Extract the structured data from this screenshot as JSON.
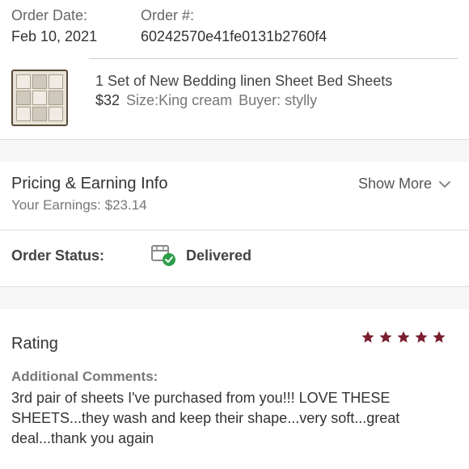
{
  "order": {
    "date_label": "Order Date:",
    "date_value": "Feb 10, 2021",
    "number_label": "Order #:",
    "number_value": "60242570e41fe0131b2760f4"
  },
  "item": {
    "title": "1 Set of New Bedding linen Sheet Bed Sheets",
    "price": "$32",
    "size": "Size:King cream",
    "buyer": "Buyer: stylly"
  },
  "pricing": {
    "title": "Pricing & Earning Info",
    "earnings": "Your Earnings: $23.14",
    "show_more": "Show More"
  },
  "status": {
    "label": "Order Status:",
    "value": "Delivered",
    "icon": "delivered-box-icon",
    "icon_color": "#2e9d4a"
  },
  "rating": {
    "title": "Rating",
    "stars": 5,
    "star_color": "#7a1f2e",
    "comments_label": "Additional Comments:",
    "comments_text": "3rd pair of sheets I've purchased from you!!! LOVE THESE SHEETS...they wash and keep their shape...very soft...great deal...thank you again"
  }
}
